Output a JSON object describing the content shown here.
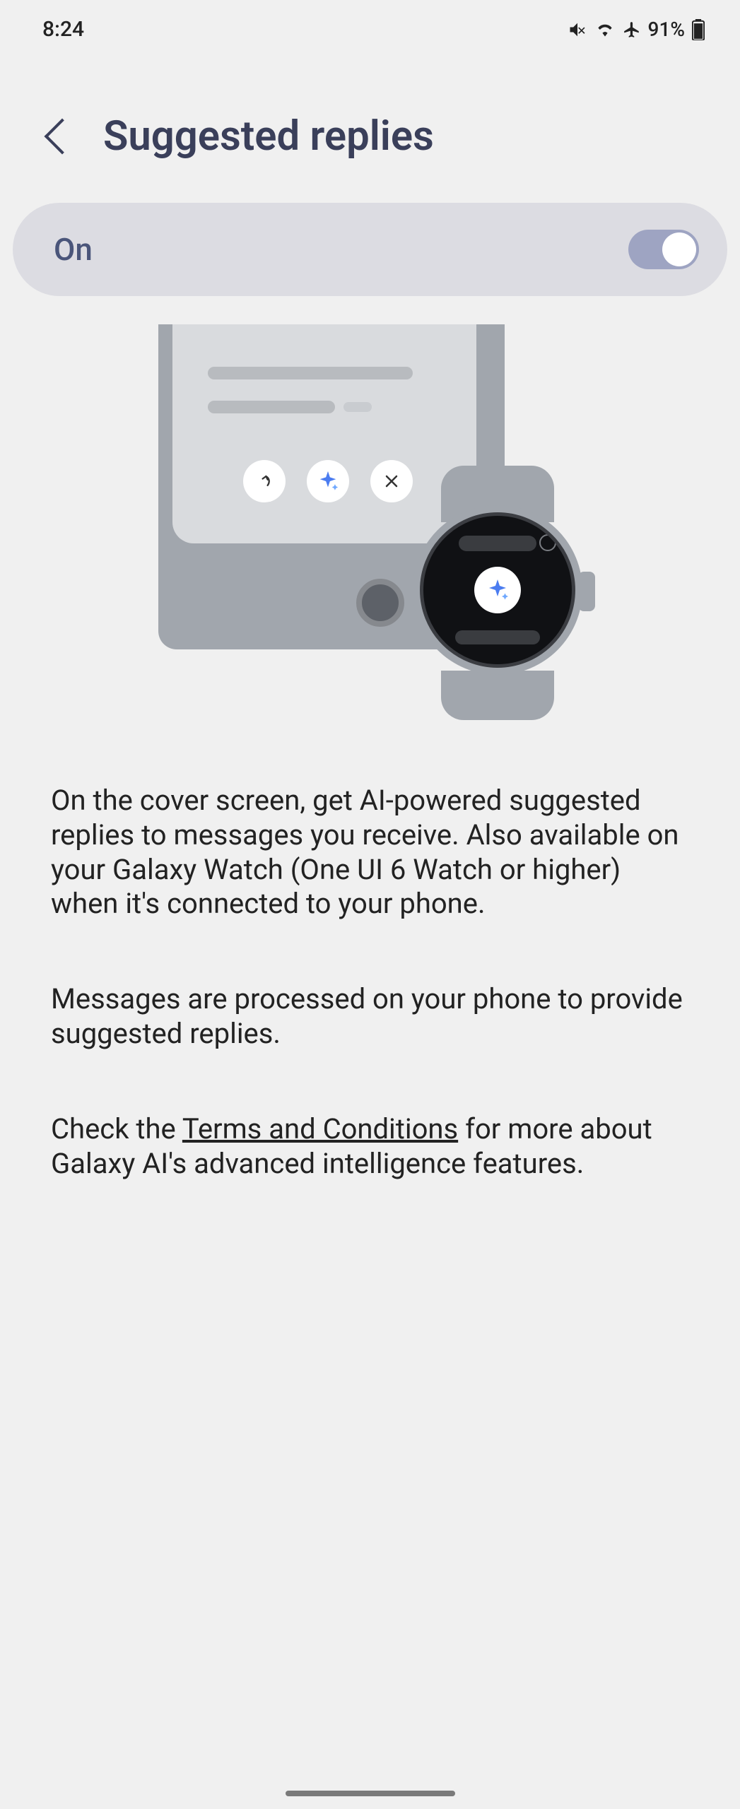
{
  "status": {
    "time": "8:24",
    "battery_text": "91%"
  },
  "header": {
    "title": "Suggested replies"
  },
  "toggle": {
    "label": "On",
    "state": "on"
  },
  "description": {
    "p1": "On the cover screen, get AI-powered suggested replies to messages you receive. Also available on your Galaxy Watch (One UI 6 Watch or higher) when it's connected to your phone.",
    "p2": "Messages are processed on your phone to provide suggested replies.",
    "p3a": "Check the ",
    "p3_link": "Terms and Conditions",
    "p3b": " for more about Galaxy AI's advanced intelligence features."
  }
}
